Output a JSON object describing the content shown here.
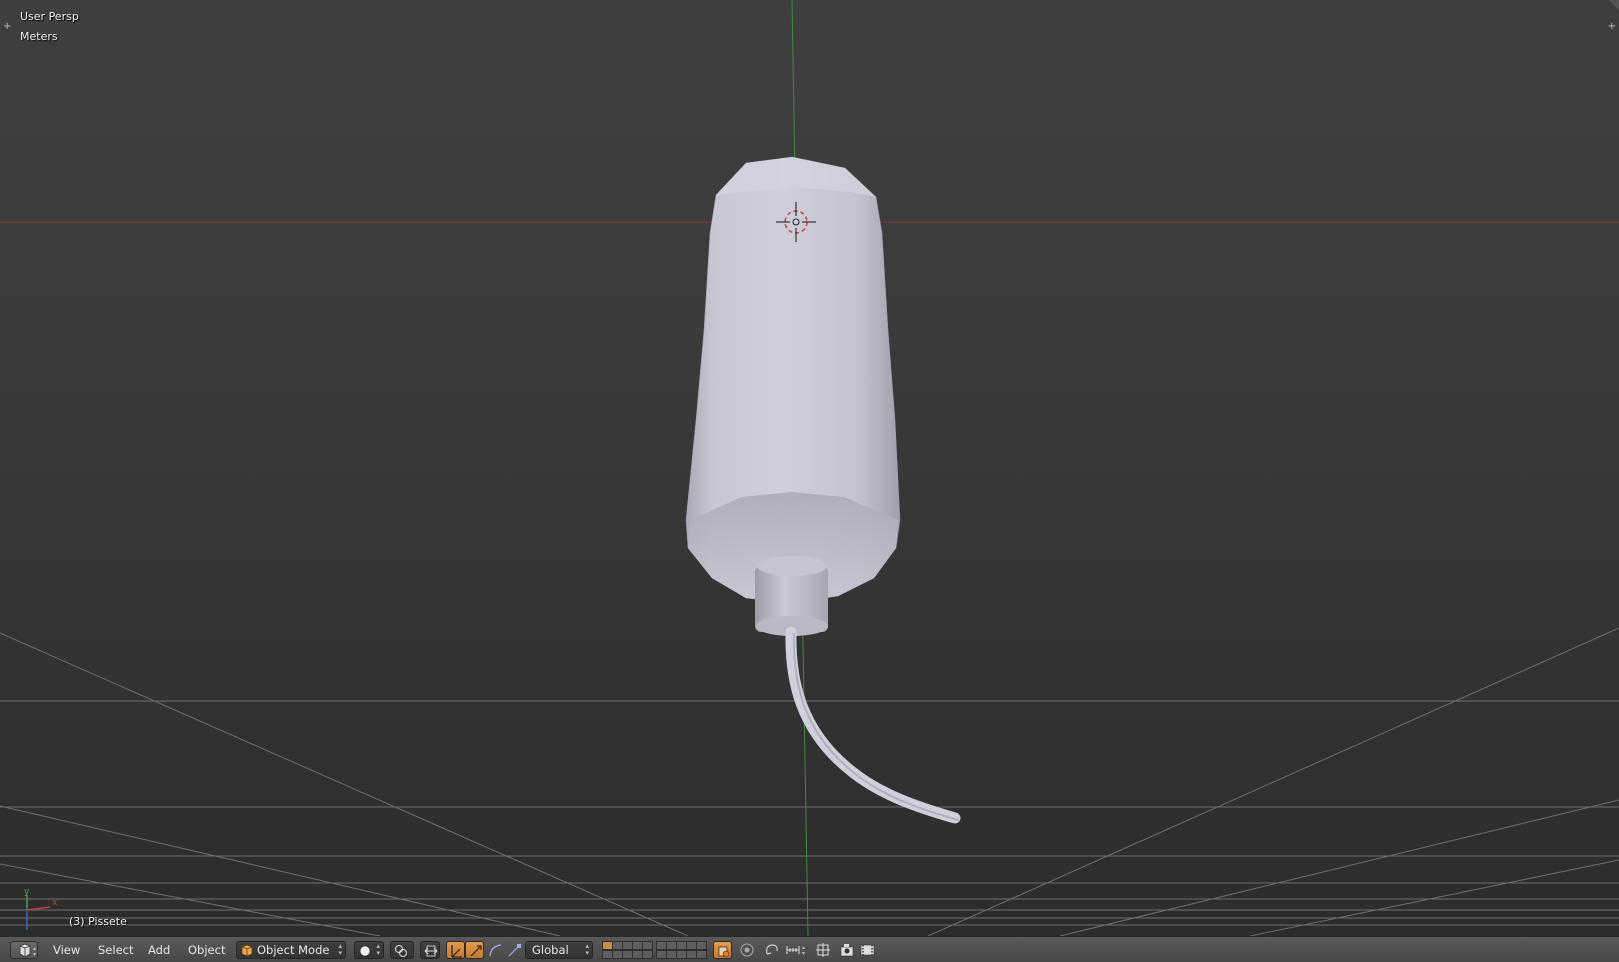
{
  "viewport": {
    "view_name": "User Persp",
    "unit_label": "Meters",
    "object_info": "(3) Pissete",
    "axis_labels": {
      "y": "y",
      "x": "x"
    },
    "colors": {
      "x_axis": "#c04040",
      "y_axis": "#4aa04a",
      "z_axis": "#3a5fd0",
      "object": "#c8c8d8",
      "background": "#393939"
    }
  },
  "header": {
    "editor_type_icon": "3d-view-icon",
    "menus": [
      "View",
      "Select",
      "Add",
      "Object"
    ],
    "mode": {
      "icon": "object-mode-cube-icon",
      "label": "Object Mode"
    },
    "viewport_shading_icon": "solid-sphere-icon",
    "pivot_icon": "pivot-point-icon",
    "manipulator_icons": [
      "translate-manipulator-icon",
      "rotate-manipulator-icon",
      "arc-icon",
      "scale-manipulator-icon"
    ],
    "transform_orientation": "Global",
    "layer_icons": [
      "layers-grid-1-icon",
      "layers-grid-2-icon"
    ],
    "right_icons": [
      "lock-camera-icon",
      "proportional-edit-icon",
      "snap-icon",
      "snap-target-icon",
      "opengl-render-icon",
      "render-animation-icon"
    ]
  }
}
